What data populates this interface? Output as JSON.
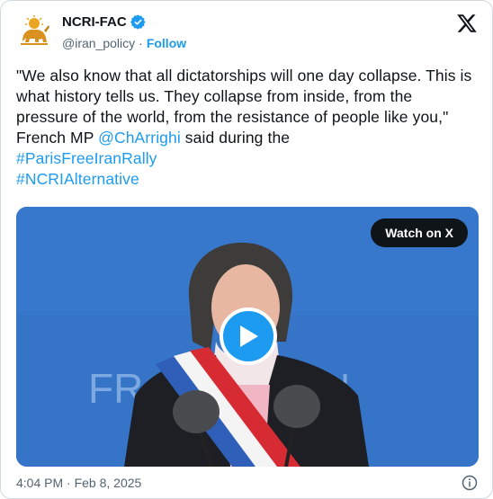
{
  "author": {
    "name": "NCRI-FAC",
    "handle": "@iran_policy",
    "follow_label": "Follow",
    "verified": true
  },
  "tweet": {
    "text_main": "\"We also know that all dictatorships will one day collapse. This is what history tells us. They collapse from inside, from the pressure of the world, from the resistance of people like you,\" French MP ",
    "mention": "@ChArrighi",
    "text_after": " said during the",
    "hashtags": [
      "#ParisFreeIranRally",
      "#NCRIAlternative"
    ]
  },
  "media": {
    "watch_label": "Watch on X",
    "background_text": "FR          N"
  },
  "footer": {
    "time": "4:04 PM",
    "separator": " · ",
    "date": "Feb 8, 2025"
  },
  "colors": {
    "accent": "#1d9bf0",
    "text": "#0f1419",
    "muted": "#536471"
  },
  "icons": [
    "lion-sun-logo-icon",
    "verified-badge-icon",
    "x-logo-icon",
    "play-icon",
    "info-icon"
  ]
}
